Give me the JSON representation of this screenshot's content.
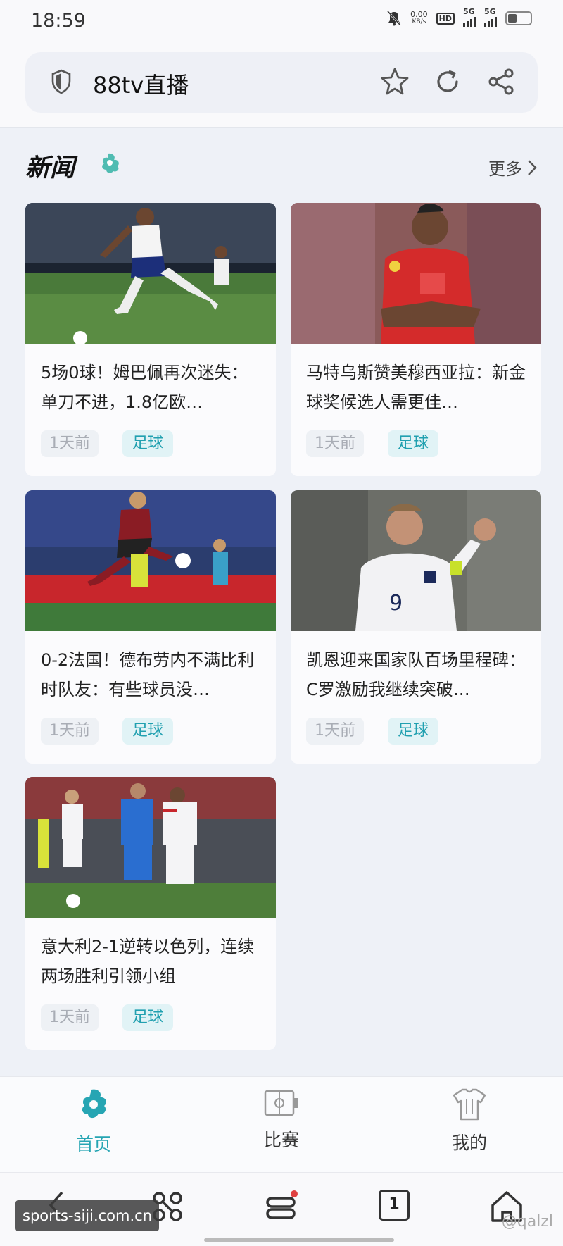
{
  "status_bar": {
    "time": "18:59",
    "net_speed_value": "0.00",
    "net_speed_unit": "KB/s",
    "hd_label": "HD",
    "sim1_label": "5G",
    "sim2_label": "5G"
  },
  "address_bar": {
    "title": "88tv直播",
    "icons": [
      "shield-icon",
      "star-icon",
      "refresh-icon",
      "share-icon"
    ]
  },
  "news_section": {
    "title": "新闻",
    "more_label": "更多"
  },
  "news": [
    {
      "title": "5场0球！姆巴佩再次迷失：单刀不进，1.8亿欧…",
      "time": "1天前",
      "category": "足球"
    },
    {
      "title": "马特乌斯赞美穆西亚拉：新金球奖候选人需更佳…",
      "time": "1天前",
      "category": "足球"
    },
    {
      "title": "0-2法国！德布劳内不满比利时队友：有些球员没…",
      "time": "1天前",
      "category": "足球"
    },
    {
      "title": "凯恩迎来国家队百场里程碑：C罗激励我继续突破…",
      "time": "1天前",
      "category": "足球"
    },
    {
      "title": "意大利2-1逆转以色列，连续两场胜利引领小组",
      "time": "1天前",
      "category": "足球"
    }
  ],
  "tabbar": {
    "home": "首页",
    "match": "比赛",
    "mine": "我的"
  },
  "browser_nav": {
    "tabs_count": "1"
  },
  "watermark": "sports-siji.com.cn",
  "credit": "@qalzl",
  "colors": {
    "accent": "#26a5b3",
    "background": "#eef1f7",
    "card": "#fbfbfd",
    "tag_category_bg": "#e1f3f6"
  }
}
